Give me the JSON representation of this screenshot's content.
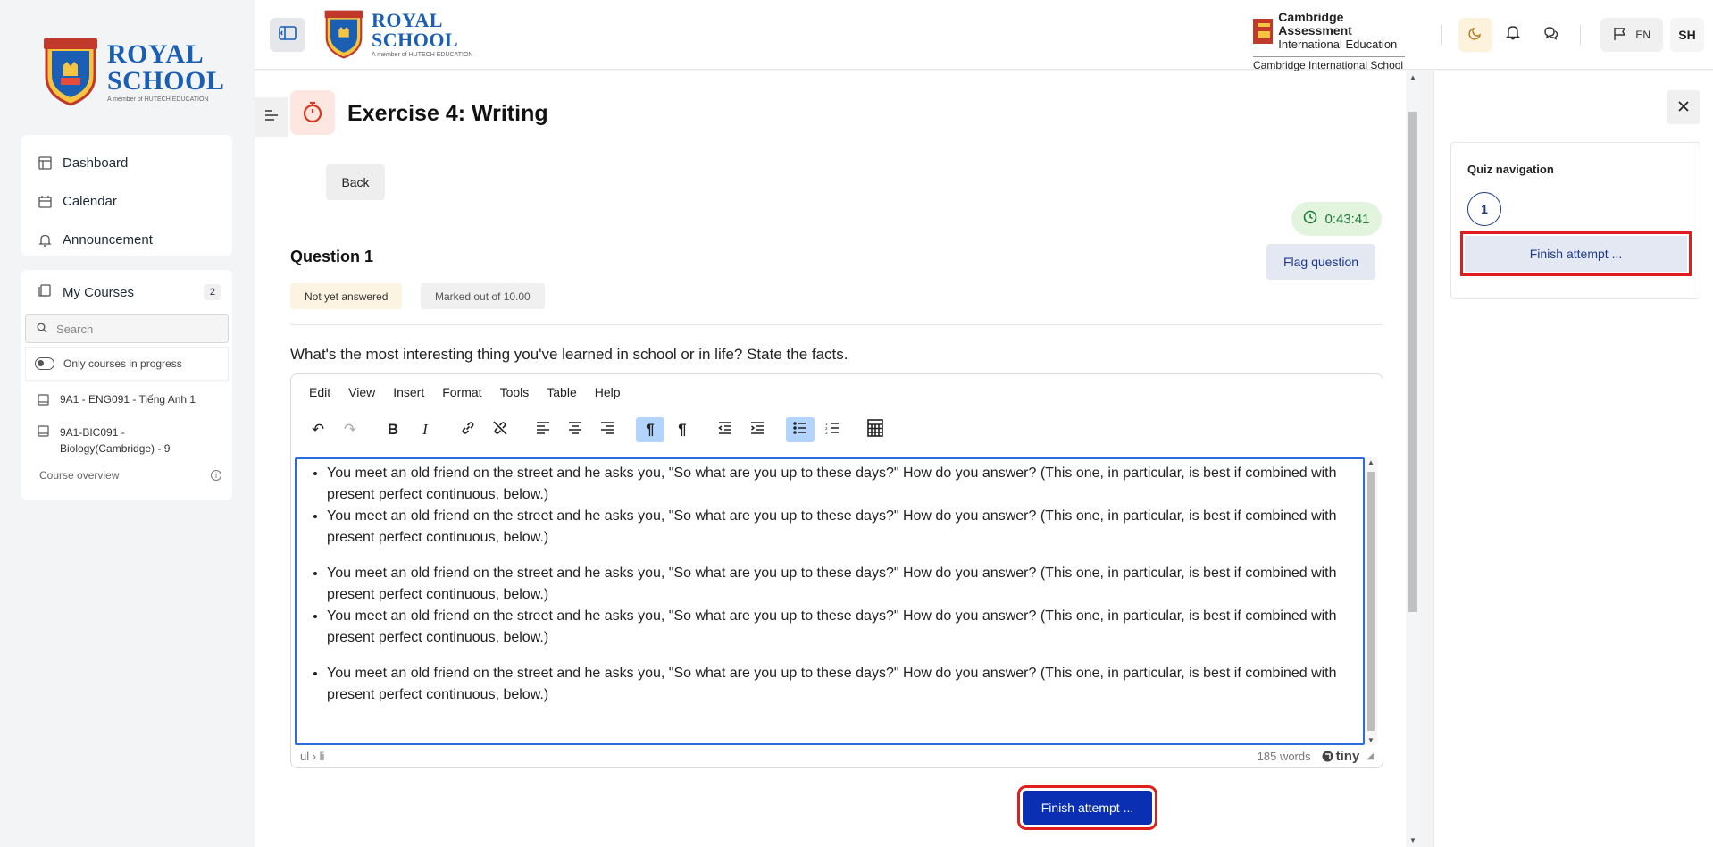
{
  "brand": {
    "line1": "ROYAL",
    "line2": "SCHOOL",
    "tagline": "A member of HUTECH EDUCATION",
    "shield_text": "ROYAL"
  },
  "sidebar": {
    "nav": [
      {
        "label": "Dashboard",
        "icon": "dashboard-icon"
      },
      {
        "label": "Calendar",
        "icon": "calendar-icon"
      },
      {
        "label": "Announcement",
        "icon": "bell-icon"
      }
    ],
    "my_courses": {
      "label": "My Courses",
      "count": "2",
      "search_placeholder": "Search",
      "toggle_label": "Only courses in progress",
      "courses": [
        {
          "name": "9A1 - ENG091 - Tiếng Anh 1"
        },
        {
          "name": "9A1-BIC091 - Biology(Cambridge) - 9"
        }
      ],
      "overview_label": "Course overview"
    }
  },
  "header": {
    "cambridge": {
      "line1": "Cambridge Assessment",
      "line2": "International Education",
      "line3": "Cambridge International School"
    },
    "lang": "EN",
    "avatar": "SH"
  },
  "exercise": {
    "title": "Exercise 4: Writing",
    "back_label": "Back",
    "timer": "0:43:41",
    "question_title": "Question 1",
    "flag_label": "Flag question",
    "status": "Not yet answered",
    "marks": "Marked out of 10.00",
    "prompt": "What's the most interesting thing you've learned in school or in life? State the facts."
  },
  "editor": {
    "menu": [
      "Edit",
      "View",
      "Insert",
      "Format",
      "Tools",
      "Table",
      "Help"
    ],
    "paragraphs": [
      "You meet an old friend on the street and he asks you, \"So what are you up to these days?\" How do you answer? (This one, in particular, is best if combined with present perfect continuous, below.)",
      "You meet an old friend on the street and he asks you, \"So what are you up to these days?\" How do you answer? (This one, in particular, is best if combined with present perfect continuous, below.)",
      "You meet an old friend on the street and he asks you, \"So what are you up to these days?\" How do you answer? (This one, in particular, is best if combined with present perfect continuous, below.)",
      "You meet an old friend on the street and he asks you, \"So what are you up to these days?\" How do you answer? (This one, in particular, is best if combined with present perfect continuous, below.)",
      "You meet an old friend on the street and he asks you, \"So what are you up to these days?\" How do you answer? (This one, in particular, is best if combined with present perfect continuous, below.)"
    ],
    "path": "ul › li",
    "word_count": "185 words",
    "brand": "tiny"
  },
  "finish_label": "Finish attempt ...",
  "quiz_nav": {
    "title": "Quiz navigation",
    "question_number": "1",
    "finish_label": "Finish attempt ..."
  },
  "colors": {
    "primary": "#0a2fb3",
    "brand_blue": "#1a5fb4",
    "highlight_outline": "#e11d1d",
    "timer_bg": "#e3f4de"
  }
}
